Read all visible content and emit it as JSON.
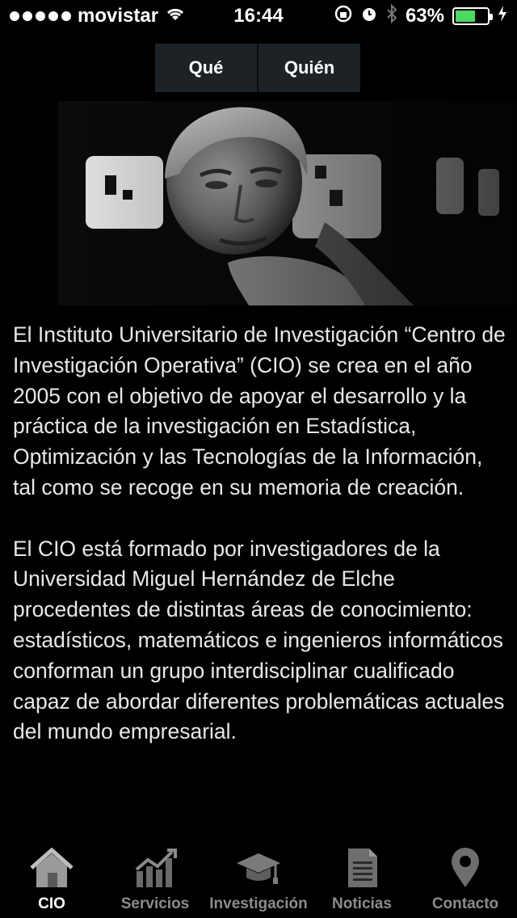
{
  "status_bar": {
    "carrier": "movistar",
    "time": "16:44",
    "battery_percent": "63%",
    "battery_level": 0.63,
    "signal_bars": 5
  },
  "segmented": {
    "que_label": "Qué",
    "quien_label": "Quién"
  },
  "content": {
    "paragraph_1": "El Instituto Universitario de Investigación “Centro de Investigación Operativa” (CIO) se crea en el año 2005 con el objetivo de apoyar el desarrollo y la práctica de la investigación en Estadística, Optimización y las Tecnologías de la Información, tal como se recoge en su memoria de creación.",
    "paragraph_2": "El CIO está formado por investigadores de la Universidad Miguel Hernández de Elche procedentes de distintas áreas de conocimiento: estadísticos, matemáticos e ingenieros informáticos conforman un grupo interdisciplinar cualificado capaz de abordar diferentes problemáticas actuales del mundo empresarial."
  },
  "tabbar": {
    "tabs": [
      {
        "label": "CIO",
        "icon": "home-icon",
        "active": true
      },
      {
        "label": "Servicios",
        "icon": "chart-icon",
        "active": false
      },
      {
        "label": "Investigación",
        "icon": "graduation-cap-icon",
        "active": false
      },
      {
        "label": "Noticias",
        "icon": "document-icon",
        "active": false
      },
      {
        "label": "Contacto",
        "icon": "location-pin-icon",
        "active": false
      }
    ]
  },
  "colors": {
    "active_tab": "#ffffff",
    "inactive_tab": "#8c8c8c",
    "battery": "#4cd964"
  }
}
